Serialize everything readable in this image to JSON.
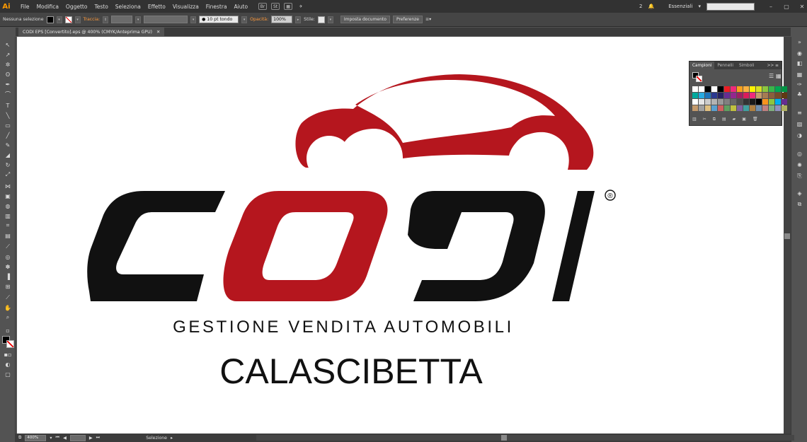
{
  "app": {
    "logo": "Ai"
  },
  "menu": [
    "File",
    "Modifica",
    "Oggetto",
    "Testo",
    "Seleziona",
    "Effetto",
    "Visualizza",
    "Finestra",
    "Aiuto"
  ],
  "menubar_right": {
    "notifications": "2",
    "workspace": "Essenziali",
    "minimize": "–",
    "maximize": "▢",
    "close": "✕"
  },
  "control": {
    "selection": "Nessuna selezione",
    "stroke_label": "Traccia:",
    "stroke_profile": "10 pt tondo",
    "opacity_label": "Opacità:",
    "opacity_value": "100%",
    "style_label": "Stile:",
    "doc_setup": "Imposta documento",
    "preferences": "Preferenze"
  },
  "document": {
    "tab": "CODI EPS [Convertito].eps @ 400% (CMYK/Anteprima GPU)",
    "close": "✕"
  },
  "logo_art": {
    "registered": "®",
    "tagline": "GESTIONE VENDITA AUTOMOBILI",
    "city": "CALASCIBETTA"
  },
  "panel": {
    "tabs": [
      "Campioni",
      "Pennelli",
      "Simboli"
    ],
    "menu": ">> ≡"
  },
  "status": {
    "zoom": "400%",
    "tool": "Selezione"
  },
  "colors": {
    "brand_red": "#b5161e",
    "brand_black": "#111111",
    "accent_orange": "#ff9a00"
  },
  "swatches": [
    "#ffffff",
    "#ffffff",
    "#000000",
    "#ffffff",
    "#000000",
    "#ec1c24",
    "#ee2a7b",
    "#f9a01b",
    "#fbb040",
    "#fff200",
    "#d7df23",
    "#8dc63f",
    "#39b54a",
    "#00a651",
    "#009444",
    "#00a99d",
    "#27aae1",
    "#1c75bc",
    "#2b3990",
    "#262262",
    "#662d91",
    "#92278f",
    "#9e1f63",
    "#da1c5c",
    "#ee2a7b",
    "#c69c6d",
    "#a67c52",
    "#8b5e3c",
    "#754c29",
    "#603913",
    "#ffffff",
    "#e6e6e6",
    "#cccccc",
    "#b3b3b3",
    "#999999",
    "#808080",
    "#666666",
    "#4d4d4d",
    "#333333",
    "#1a1a1a",
    "#000000",
    "#f7931e",
    "#8dc63f",
    "#00aeef",
    "#662d91",
    "#c49a6c",
    "#a0a0a0",
    "#e0c080",
    "#5aa0d0",
    "#d06060",
    "#60a060",
    "#c0c040",
    "#8060a0",
    "#40a0a0",
    "#b08040",
    "#7090b0",
    "#c08080",
    "#80b080",
    "#9090c0",
    "#b0b060"
  ]
}
